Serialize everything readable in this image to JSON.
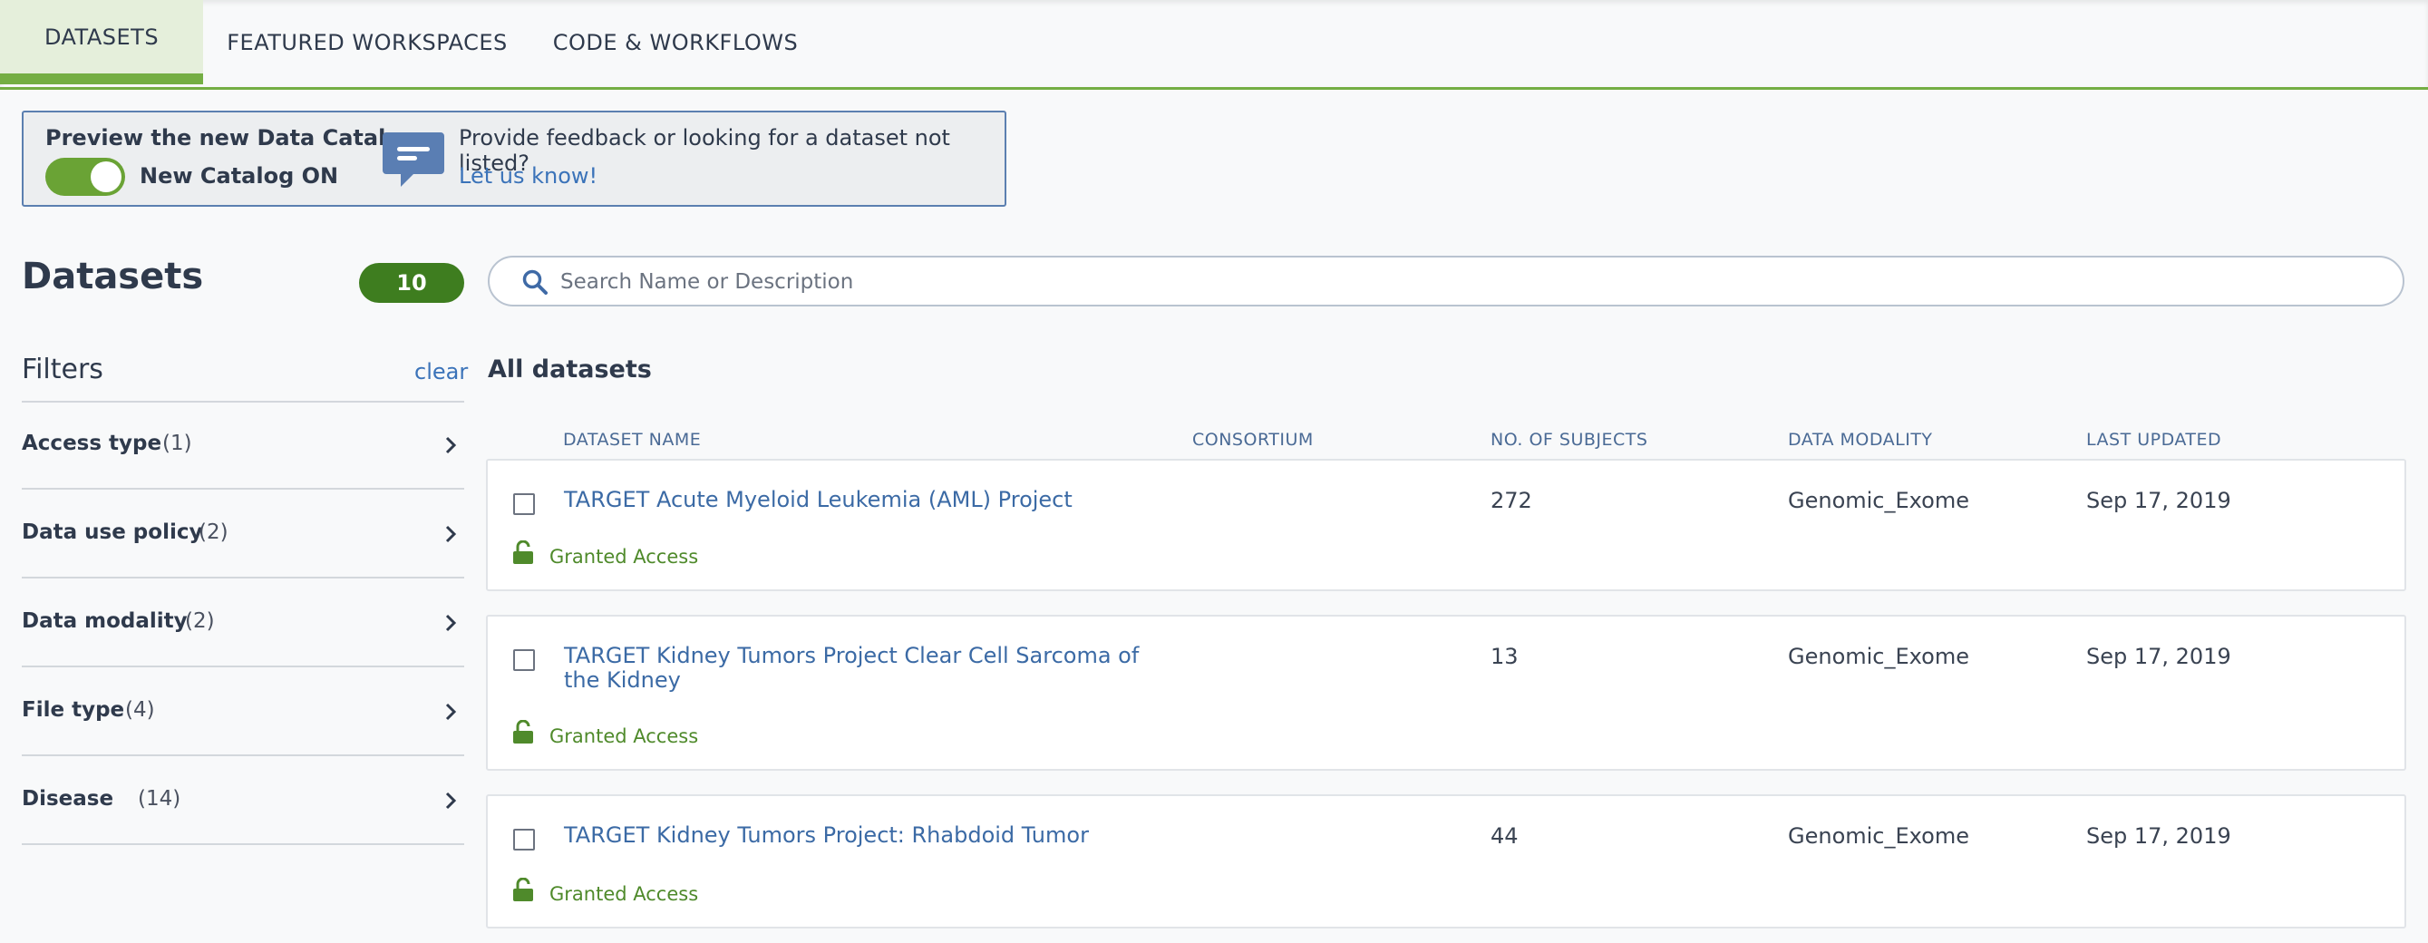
{
  "tabs": [
    {
      "label": "DATASETS",
      "active": true
    },
    {
      "label": "FEATURED WORKSPACES",
      "active": false
    },
    {
      "label": "CODE & WORKFLOWS",
      "active": false
    }
  ],
  "banner": {
    "title": "Preview the new Data Catalog",
    "toggle_label": "New Catalog ON",
    "toggle_on": true,
    "feedback_text": "Provide feedback or looking for a dataset not listed?",
    "feedback_link": "Let us know!"
  },
  "page": {
    "title": "Datasets",
    "count": "10"
  },
  "search": {
    "placeholder": "Search Name or Description",
    "value": ""
  },
  "filters": {
    "title": "Filters",
    "clear_label": "clear",
    "items": [
      {
        "name": "Access type",
        "count": "(1)"
      },
      {
        "name": "Data use policy",
        "count": "(2)"
      },
      {
        "name": "Data modality",
        "count": "(2)"
      },
      {
        "name": "File type",
        "count": "(4)"
      },
      {
        "name": "Disease",
        "count": "(14)"
      }
    ]
  },
  "list": {
    "title": "All datasets",
    "columns": {
      "name": "DATASET NAME",
      "consortium": "CONSORTIUM",
      "subjects": "NO. OF SUBJECTS",
      "modality": "DATA MODALITY",
      "updated": "LAST UPDATED"
    },
    "rows": [
      {
        "name": "TARGET Acute Myeloid Leukemia (AML) Project",
        "consortium": "",
        "subjects": "272",
        "modality": "Genomic_Exome",
        "updated": "Sep 17, 2019",
        "access": "Granted Access"
      },
      {
        "name": "TARGET Kidney Tumors Project Clear Cell Sarcoma of the Kidney",
        "consortium": "",
        "subjects": "13",
        "modality": "Genomic_Exome",
        "updated": "Sep 17, 2019",
        "access": "Granted Access"
      },
      {
        "name": "TARGET Kidney Tumors Project: Rhabdoid Tumor",
        "consortium": "",
        "subjects": "44",
        "modality": "Genomic_Exome",
        "updated": "Sep 17, 2019",
        "access": "Granted Access"
      }
    ]
  },
  "colors": {
    "accent_green": "#74ae43",
    "badge_green": "#3e7d1f",
    "link_blue": "#3b73b9",
    "access_green": "#4f8a2b"
  }
}
